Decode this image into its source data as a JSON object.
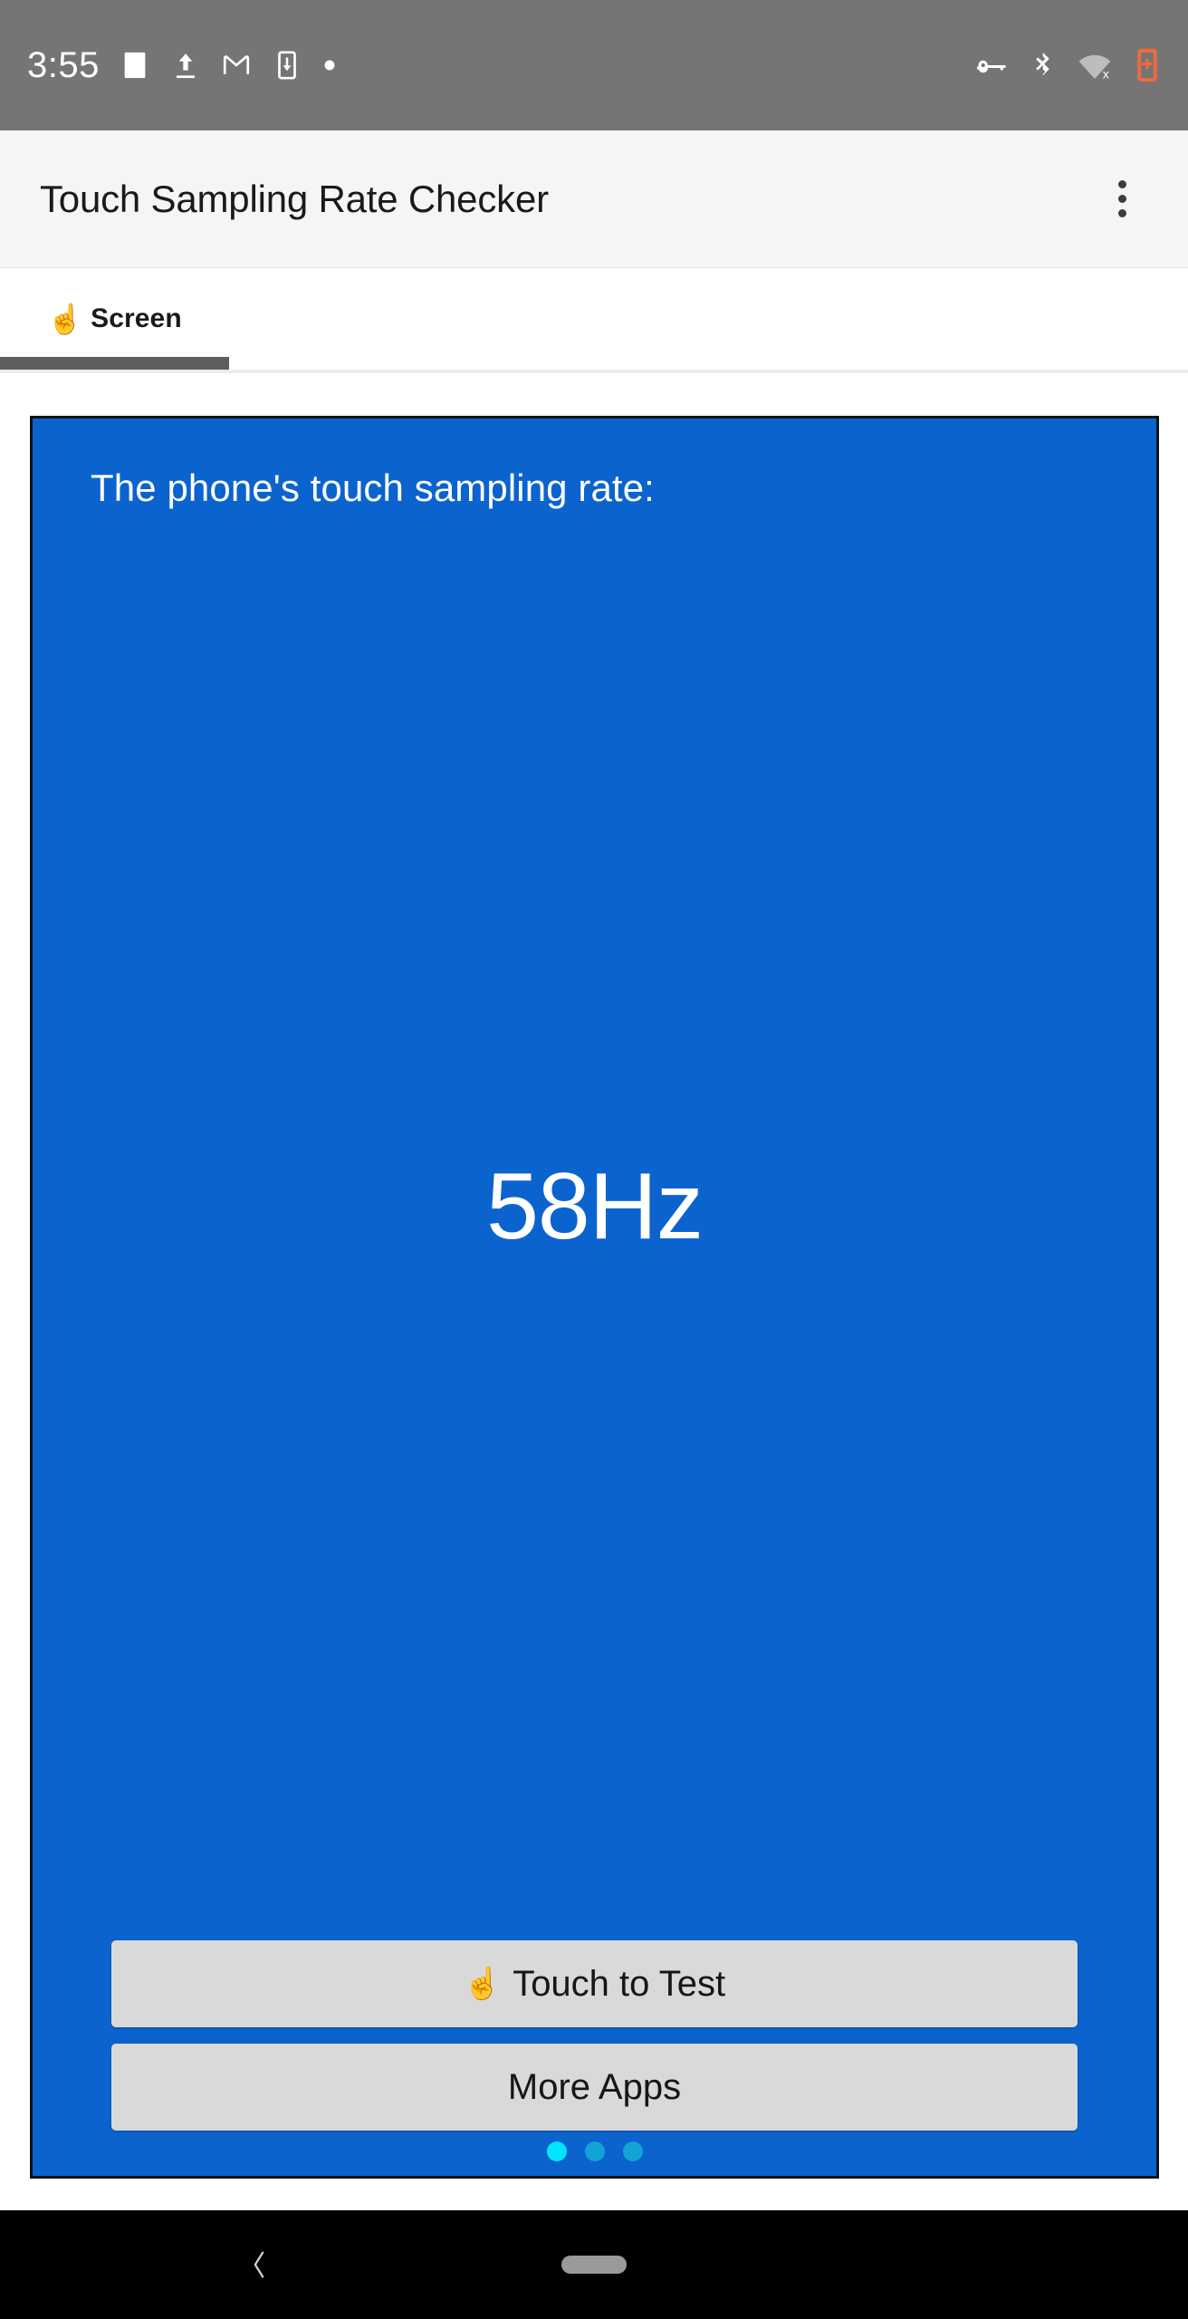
{
  "status_bar": {
    "time": "3:55",
    "left_icons": [
      "image-icon",
      "upload-icon",
      "gmail-icon",
      "app-download-icon",
      "dot-icon"
    ],
    "right_icons": [
      "vpn-key-icon",
      "bluetooth-icon",
      "wifi-off-icon",
      "battery-charging-icon"
    ],
    "background_color": "#757575",
    "battery_color": "#f4693c"
  },
  "app_bar": {
    "title": "Touch Sampling Rate Checker",
    "overflow_label": "More options"
  },
  "tabs": [
    {
      "label": "Screen",
      "icon": "☝",
      "selected": true
    }
  ],
  "main": {
    "panel_color": "#0b63ce",
    "caption": "The phone's touch sampling rate:",
    "rate_value": "58Hz",
    "rate_number": 58,
    "rate_unit": "Hz",
    "buttons": [
      {
        "label": "Touch to Test",
        "icon": "☝",
        "name": "touch-to-test-button"
      },
      {
        "label": "More Apps",
        "icon": "",
        "name": "more-apps-button"
      }
    ],
    "page_dots": {
      "count": 3,
      "active_index": 0,
      "active_color": "#00e5ff",
      "inactive_color": "#12a4d4"
    }
  },
  "nav_bar": {
    "back_label": "Back",
    "home_label": "Home",
    "background_color": "#000000"
  }
}
